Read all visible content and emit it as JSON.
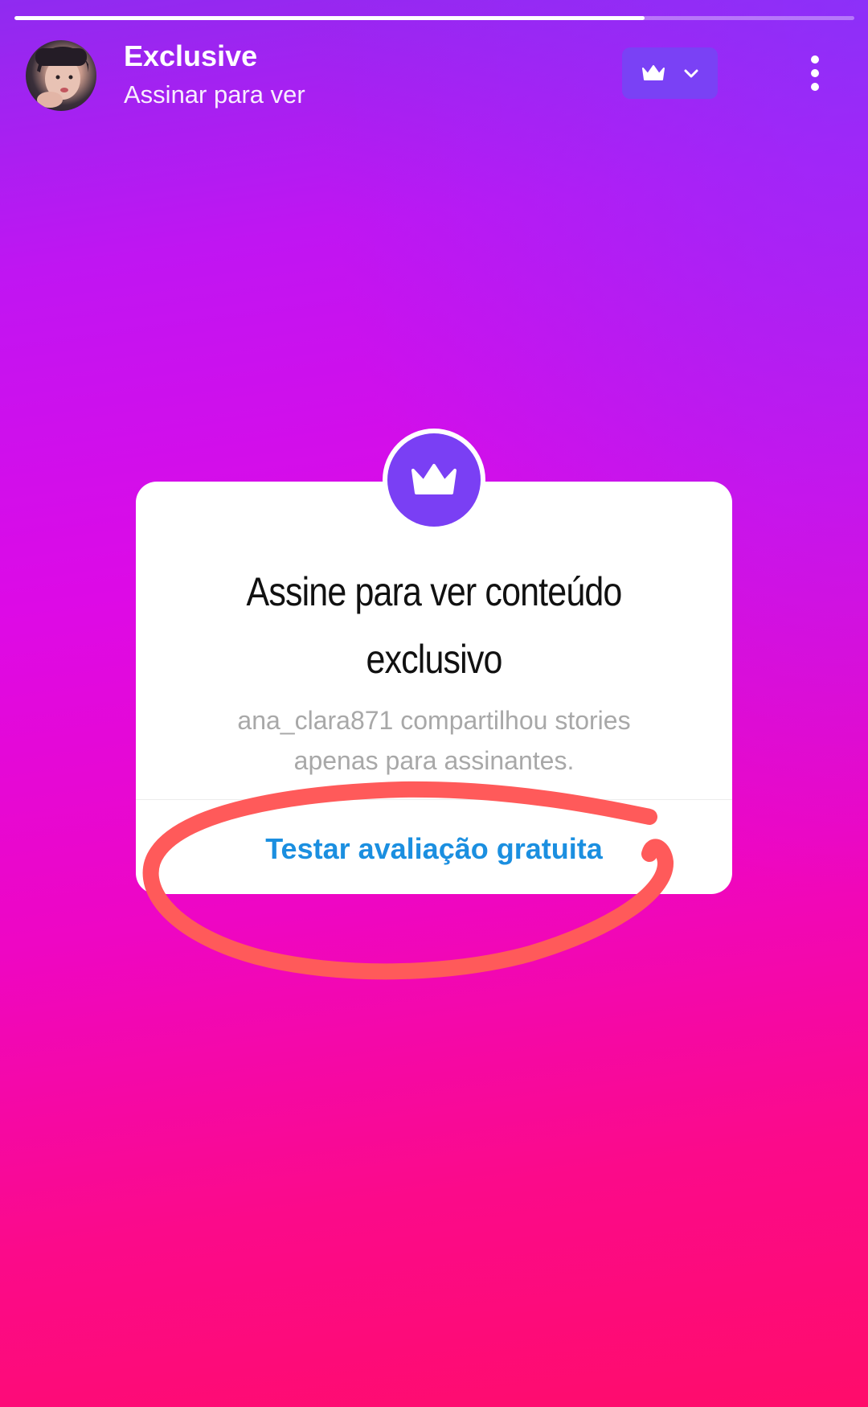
{
  "story": {
    "progress": 0.75,
    "header": {
      "title": "Exclusive",
      "subtitle": "Assinar para ver",
      "avatar_icon": "profile-photo",
      "subscribe_button_icons": [
        "crown-icon",
        "chevron-down-icon"
      ],
      "more_icon": "more-vertical-icon"
    },
    "card": {
      "badge_icon": "crown-icon",
      "title_line1": "Assine para ver conteúdo",
      "title_line2": "exclusivo",
      "desc_line1": "ana_clara871 compartilhou stories",
      "desc_line2": "apenas para assinantes.",
      "action_label": "Testar avaliação gratuita"
    }
  },
  "colors": {
    "accent_purple": "#7a3ff4",
    "link_blue": "#1b8fe0",
    "annotation_red": "#ff5a5a"
  }
}
